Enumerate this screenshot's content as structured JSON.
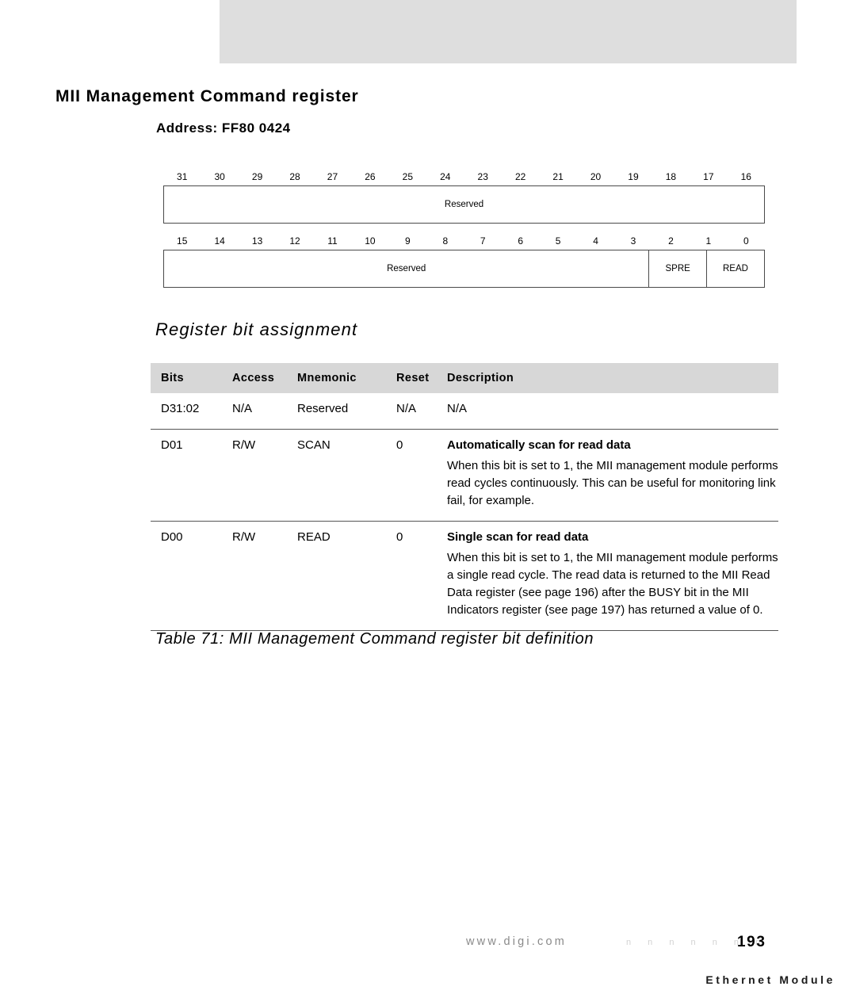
{
  "header": {
    "running_title": "Ethernet Module",
    "band_color": "#dedede"
  },
  "page": {
    "section_title": "MII Management Command register",
    "address_label": "Address: FF80 0424",
    "subheading": "Register bit assignment",
    "table_caption": "Table 71: MII Management Command register bit definition"
  },
  "bit_diagram": {
    "rows": [
      {
        "bit_labels": [
          "31",
          "30",
          "29",
          "28",
          "27",
          "26",
          "25",
          "24",
          "23",
          "22",
          "21",
          "20",
          "19",
          "18",
          "17",
          "16"
        ],
        "fields": [
          {
            "label": "Reserved",
            "span": 16
          }
        ]
      },
      {
        "bit_labels": [
          "15",
          "14",
          "13",
          "12",
          "11",
          "10",
          "9",
          "8",
          "7",
          "6",
          "5",
          "4",
          "3",
          "2",
          "1",
          "0"
        ],
        "fields": [
          {
            "label": "Reserved",
            "span": 14
          },
          {
            "label": "SPRE",
            "span": 1
          },
          {
            "label": "READ",
            "span": 1
          }
        ]
      }
    ]
  },
  "bit_table": {
    "headers": [
      "Bits",
      "Access",
      "Mnemonic",
      "Reset",
      "Description"
    ],
    "rows": [
      {
        "bits": "D31:02",
        "access": "N/A",
        "mnemonic": "Reserved",
        "reset": "N/A",
        "desc_title": "N/A",
        "desc_body": ""
      },
      {
        "bits": "D01",
        "access": "R/W",
        "mnemonic": "SCAN",
        "reset": "0",
        "desc_title": "Automatically scan for read data",
        "desc_body": "When this bit is set to 1, the MII management module performs read cycles continuously. This can be useful for monitoring link fail, for example."
      },
      {
        "bits": "D00",
        "access": "R/W",
        "mnemonic": "READ",
        "reset": "0",
        "desc_title": "Single scan for read data",
        "desc_body": "When this bit is set to 1, the MII management module performs a single read cycle. The read data is returned to the MII Read Data register (see page 196) after the BUSY bit in the MII Indicators register (see page 197) has returned a value of 0."
      }
    ]
  },
  "footer": {
    "url": "www.digi.com",
    "leaders": "n n n n n n n",
    "page_number": "193"
  }
}
